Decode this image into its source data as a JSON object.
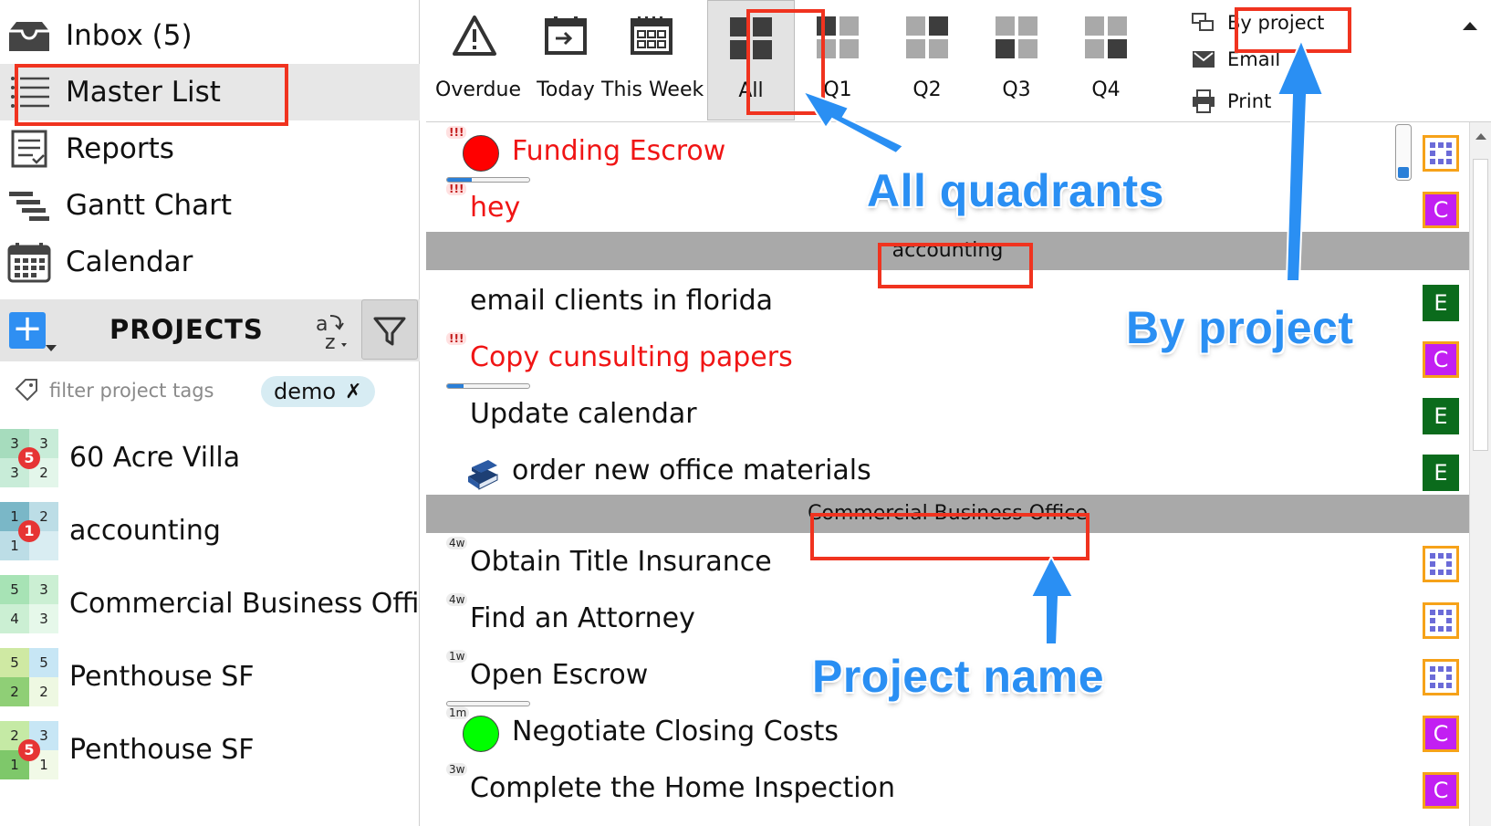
{
  "nav": [
    {
      "key": "inbox",
      "label": "Inbox (5)",
      "icon": "inbox-icon"
    },
    {
      "key": "master-list",
      "label": "Master List",
      "icon": "list-icon",
      "active": true
    },
    {
      "key": "reports",
      "label": "Reports",
      "icon": "report-icon"
    },
    {
      "key": "gantt",
      "label": "Gantt Chart",
      "icon": "gantt-icon"
    },
    {
      "key": "calendar",
      "label": "Calendar",
      "icon": "calendar-icon"
    }
  ],
  "projects_header": {
    "title": "PROJECTS",
    "add_label": "+"
  },
  "tag_filter": {
    "placeholder": "filter project tags",
    "chip": "demo",
    "chip_remove": "✗"
  },
  "projects": [
    {
      "name": "60 Acre Villa",
      "q": [
        "3",
        "3",
        "3",
        "2"
      ],
      "badge": "5",
      "colors": [
        "#a6dcbd",
        "#c8ecd8",
        "#c8ecd8",
        "#e3f6ea"
      ]
    },
    {
      "name": "accounting",
      "q": [
        "1",
        "2",
        "1",
        ""
      ],
      "badge": "1",
      "colors": [
        "#7ab7c7",
        "#bcdde6",
        "#bcdde6",
        "#d9edf2"
      ]
    },
    {
      "name": "Commercial Business Office",
      "q": [
        "5",
        "3",
        "4",
        "3"
      ],
      "badge": "",
      "colors": [
        "#a7e3b5",
        "#cbefd3",
        "#cbefd3",
        "#e6f8ea"
      ]
    },
    {
      "name": "Penthouse SF",
      "q": [
        "5",
        "5",
        "2",
        "2"
      ],
      "badge": "",
      "colors": [
        "#cfe9a3",
        "#c7e6f5",
        "#8fcf76",
        "#eef8e2"
      ]
    },
    {
      "name": "Penthouse SF",
      "q": [
        "2",
        "3",
        "1",
        "1"
      ],
      "badge": "5",
      "colors": [
        "#c5eaa5",
        "#c7e6f5",
        "#7ec86a",
        "#f1f9e7"
      ]
    }
  ],
  "toolbar": {
    "buttons": [
      {
        "key": "overdue",
        "label": "Overdue",
        "icon": "warning-icon"
      },
      {
        "key": "today",
        "label": "Today",
        "icon": "today-icon"
      },
      {
        "key": "this-week",
        "label": "This Week",
        "icon": "week-calendar-icon"
      },
      {
        "key": "all",
        "label": "All",
        "icon": "all-quadrants-icon",
        "active": true
      },
      {
        "key": "q1",
        "label": "Q1",
        "icon": "q1-icon"
      },
      {
        "key": "q2",
        "label": "Q2",
        "icon": "q2-icon"
      },
      {
        "key": "q3",
        "label": "Q3",
        "icon": "q3-icon"
      },
      {
        "key": "q4",
        "label": "Q4",
        "icon": "q4-icon"
      }
    ],
    "by_project": "By project",
    "email": "Email",
    "print": "Print"
  },
  "tasks": {
    "top": [
      {
        "label": "Funding Escrow",
        "red": true,
        "priority": "!!!",
        "dot": "#ff0000",
        "progress": 0.3,
        "badge": "matrix"
      },
      {
        "label": "hey",
        "red": true,
        "priority": "!!!",
        "badge": "C"
      }
    ],
    "group_accounting": "accounting",
    "accounting": [
      {
        "label": "email clients in florida",
        "badge": "E"
      },
      {
        "label": "Copy cunsulting papers",
        "red": true,
        "priority": "!!!",
        "progress": 0.2,
        "badge": "C"
      },
      {
        "label": "Update calendar",
        "badge": "E"
      },
      {
        "label": "order new office materials",
        "icon": "books-icon",
        "badge": "E"
      }
    ],
    "group_cbo": "Commercial Business Office",
    "cbo": [
      {
        "label": "Obtain Title Insurance",
        "due": "4w",
        "badge": "matrix"
      },
      {
        "label": "Find an Attorney",
        "due": "4w",
        "badge": "matrix"
      },
      {
        "label": "Open Escrow",
        "due": "1w",
        "progress": 0.0,
        "badge": "matrix"
      },
      {
        "label": "Negotiate Closing Costs",
        "due": "1m",
        "dot": "#00ff00",
        "badge": "C"
      },
      {
        "label": "Complete the Home Inspection",
        "due": "3w",
        "badge": "C"
      }
    ]
  },
  "badge_colors": {
    "E": "#0b6b1c",
    "C": "#c21ff2",
    "matrix_border": "#f6a219",
    "matrix_fill": "#6b6bd8"
  },
  "annotations": {
    "all_quadrants": "All quadrants",
    "by_project": "By project",
    "project_name": "Project name"
  }
}
